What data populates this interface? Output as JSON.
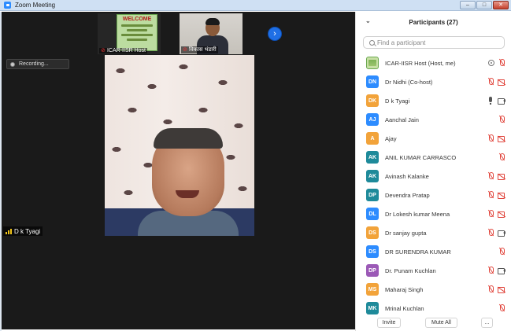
{
  "window": {
    "title": "Zoom Meeting",
    "controls": [
      "minimize",
      "maximize",
      "close"
    ]
  },
  "gallery": {
    "thumbnails": [
      {
        "name": "ICAR-IISR Host",
        "muted": true,
        "content": "welcome-slide",
        "slide_title": "WELCOME"
      },
      {
        "name": "विकास भंडारी",
        "muted": true,
        "content": "person"
      }
    ],
    "next_icon": "chevron-right-icon"
  },
  "recording": {
    "label": "Recording..."
  },
  "active_speaker": {
    "name": "D k Tyagi"
  },
  "participants": {
    "title": "Participants (27)",
    "search_placeholder": "Find a participant",
    "list": [
      {
        "initials": "",
        "avatar_color": "",
        "image": true,
        "name": "ICAR-IISR Host (Host, me)",
        "icons": [
          "host",
          "mic-muted"
        ]
      },
      {
        "initials": "DN",
        "avatar_color": "#2d8cff",
        "name": "Dr Nidhi (Co-host)",
        "icons": [
          "mic-muted",
          "video-off"
        ]
      },
      {
        "initials": "DK",
        "avatar_color": "#f2a33a",
        "name": "D k Tyagi",
        "icons": [
          "mic-on",
          "video-on"
        ]
      },
      {
        "initials": "AJ",
        "avatar_color": "#2d8cff",
        "name": "Aanchal Jain",
        "icons": [
          "mic-muted"
        ]
      },
      {
        "initials": "A",
        "avatar_color": "#f2a33a",
        "name": "Ajay",
        "icons": [
          "mic-muted",
          "video-off"
        ]
      },
      {
        "initials": "AK",
        "avatar_color": "#1e8a9a",
        "name": "ANIL KUMAR CARRASCO",
        "icons": [
          "mic-muted"
        ]
      },
      {
        "initials": "AK",
        "avatar_color": "#1e8a9a",
        "name": "Avinash Kalanke",
        "icons": [
          "mic-muted",
          "video-off"
        ]
      },
      {
        "initials": "DP",
        "avatar_color": "#1e8a9a",
        "name": "Devendra Pratap",
        "icons": [
          "mic-muted",
          "video-off"
        ]
      },
      {
        "initials": "DL",
        "avatar_color": "#2d8cff",
        "name": "Dr Lokesh kumar Meena",
        "icons": [
          "mic-muted",
          "video-off"
        ]
      },
      {
        "initials": "DS",
        "avatar_color": "#f2a33a",
        "name": "Dr sanjay gupta",
        "icons": [
          "mic-muted",
          "video-on"
        ]
      },
      {
        "initials": "DS",
        "avatar_color": "#2d8cff",
        "name": "DR SURENDRA KUMAR",
        "icons": [
          "mic-muted"
        ]
      },
      {
        "initials": "DP",
        "avatar_color": "#9b59b6",
        "name": "Dr. Punam Kuchlan",
        "icons": [
          "mic-muted",
          "video-on"
        ]
      },
      {
        "initials": "MS",
        "avatar_color": "#f2a33a",
        "name": "Maharaj Singh",
        "icons": [
          "mic-muted",
          "video-off"
        ]
      },
      {
        "initials": "MK",
        "avatar_color": "#1e8a9a",
        "name": "Mrinal Kuchlan",
        "icons": [
          "mic-muted"
        ]
      }
    ],
    "footer": {
      "invite": "Invite",
      "mute_all": "Mute All",
      "more": "..."
    }
  }
}
